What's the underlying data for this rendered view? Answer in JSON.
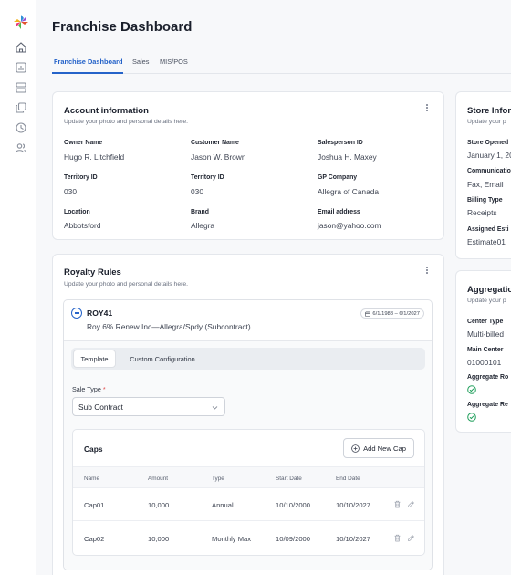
{
  "page": {
    "title": "Franchise Dashboard"
  },
  "colors": {
    "accent": "#2563c9",
    "success": "#1e9e5a",
    "required": "#e14b4b"
  },
  "sidebar": {
    "logo": "multicolor-pinwheel-logo",
    "items": [
      {
        "icon": "home-icon"
      },
      {
        "icon": "bar-chart-icon"
      },
      {
        "icon": "server-icon"
      },
      {
        "icon": "copy-icon"
      },
      {
        "icon": "clock-icon"
      },
      {
        "icon": "users-icon"
      }
    ]
  },
  "tabs": [
    {
      "label": "Franchise Dashboard",
      "active": true
    },
    {
      "label": "Sales"
    },
    {
      "label": "MIS/POS"
    }
  ],
  "account": {
    "title": "Account information",
    "subtitle": "Update your photo and personal details here.",
    "fields": [
      {
        "label": "Owner Name",
        "value": "Hugo R. Litchfield"
      },
      {
        "label": "Customer Name",
        "value": "Jason W. Brown"
      },
      {
        "label": "Salesperson ID",
        "value": "Joshua H. Maxey"
      },
      {
        "label": "Territory ID",
        "value": "030"
      },
      {
        "label": "Territory ID",
        "value": "030"
      },
      {
        "label": "GP Company",
        "value": "Allegra of Canada"
      },
      {
        "label": "Location",
        "value": "Abbotsford"
      },
      {
        "label": "Brand",
        "value": "Allegra"
      },
      {
        "label": "Email address",
        "value": "jason@yahoo.com"
      }
    ]
  },
  "store": {
    "title": "Store Infor",
    "subtitle": "Update your p",
    "fields": [
      {
        "label": "Store Opened",
        "value": "January 1, 20"
      },
      {
        "label": "Communicatio",
        "value": "Fax, Email"
      },
      {
        "label": "Billing Type",
        "value": "Receipts"
      },
      {
        "label": "Assigned Esti",
        "value": "Estimate01"
      }
    ]
  },
  "aggregation": {
    "title": "Aggregatio",
    "subtitle": "Update your p",
    "fields": [
      {
        "label": "Center Type",
        "value": "Multi-billed"
      },
      {
        "label": "Main Center",
        "value": "01000101"
      },
      {
        "label": "Aggregate Ro",
        "value": ""
      },
      {
        "label": "Aggregate Re",
        "value": ""
      }
    ]
  },
  "royalty": {
    "title": "Royalty Rules",
    "subtitle": "Update your photo and personal details here.",
    "rule": {
      "code": "ROY41",
      "description": "Roy 6% Renew Inc—Allegra/Spdy (Subcontract)",
      "date_range": "6/1/1988 – 6/1/2027"
    },
    "subtabs": [
      {
        "label": "Template",
        "active": true
      },
      {
        "label": "Custom Configuration"
      }
    ],
    "sale_type": {
      "label": "Sale Type",
      "required_mark": "*",
      "value": "Sub Contract"
    },
    "caps": {
      "title": "Caps",
      "add_button": "Add New Cap",
      "columns": [
        "Name",
        "Amount",
        "Type",
        "Start Date",
        "End Date"
      ],
      "rows": [
        [
          "Cap01",
          "10,000",
          "Annual",
          "10/10/2000",
          "10/10/2027"
        ],
        [
          "Cap02",
          "10,000",
          "Monthly Max",
          "10/09/2000",
          "10/10/2027"
        ]
      ]
    }
  }
}
